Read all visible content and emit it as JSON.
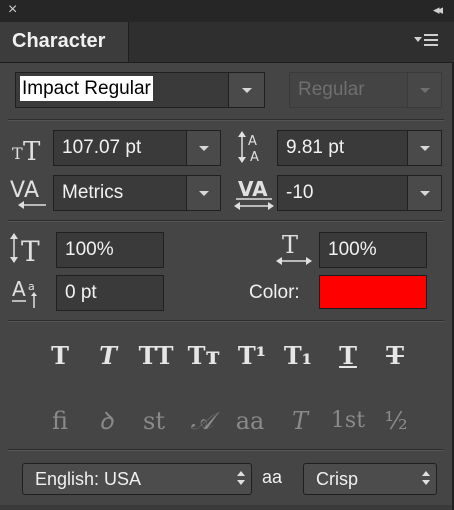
{
  "panel": {
    "title": "Character",
    "close_glyph": "×",
    "collapse_glyph": "◂◂"
  },
  "font": {
    "family": "Impact Regular",
    "style": "Regular"
  },
  "size": {
    "value": "107.07 pt"
  },
  "leading": {
    "value": "9.81 pt"
  },
  "kerning": {
    "value": "Metrics"
  },
  "tracking": {
    "value": "-10"
  },
  "vertical_scale": {
    "value": "100%"
  },
  "horizontal_scale": {
    "value": "100%"
  },
  "baseline_shift": {
    "value": "0 pt"
  },
  "color": {
    "label": "Color:",
    "swatch": "#ff0000"
  },
  "style_buttons": [
    {
      "name": "faux-bold-button",
      "glyph": "T"
    },
    {
      "name": "faux-italic-button",
      "glyph": "T"
    },
    {
      "name": "all-caps-button",
      "glyph": "TT"
    },
    {
      "name": "small-caps-button",
      "glyph": "Tт"
    },
    {
      "name": "superscript-button",
      "glyph": "T¹"
    },
    {
      "name": "subscript-button",
      "glyph": "T₁"
    },
    {
      "name": "underline-button",
      "glyph": "T"
    },
    {
      "name": "strikethrough-button",
      "glyph": "T"
    }
  ],
  "opentype_buttons": [
    {
      "name": "standard-ligatures-button",
      "glyph": "ﬁ"
    },
    {
      "name": "contextual-alternates-button",
      "glyph": "ꝺ"
    },
    {
      "name": "discretionary-ligatures-button",
      "glyph": "st"
    },
    {
      "name": "swash-button",
      "glyph": "𝒜"
    },
    {
      "name": "stylistic-alternates-button",
      "glyph": "aa"
    },
    {
      "name": "titling-alternates-button",
      "glyph": "T"
    },
    {
      "name": "ordinals-button",
      "glyph": "1st"
    },
    {
      "name": "fractions-button",
      "glyph": "½"
    }
  ],
  "language": {
    "value": "English: USA"
  },
  "antialias": {
    "icon_text": "aa",
    "value": "Crisp"
  }
}
